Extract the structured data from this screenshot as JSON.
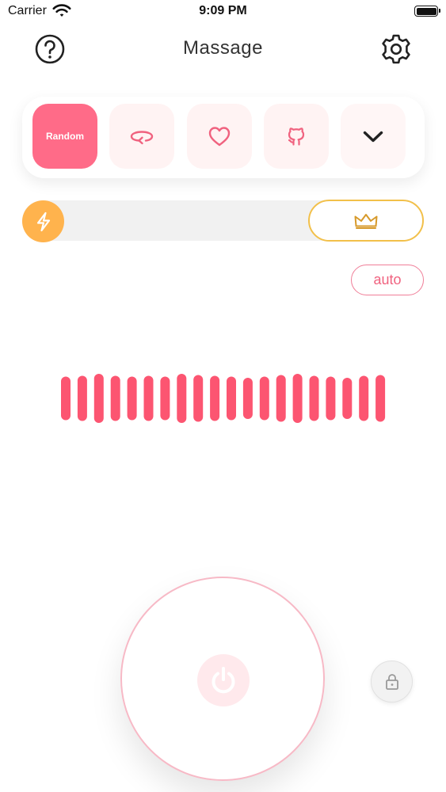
{
  "status_bar": {
    "carrier": "Carrier",
    "time": "9:09 PM"
  },
  "header": {
    "title": "Massage",
    "help_icon": "question-circle-icon",
    "settings_icon": "gear-icon"
  },
  "modes": {
    "items": [
      {
        "label": "Random",
        "icon": "",
        "active": true
      },
      {
        "label": "",
        "icon": "loop-arrow-icon",
        "active": false
      },
      {
        "label": "",
        "icon": "heart-icon",
        "active": false
      },
      {
        "label": "",
        "icon": "github-icon",
        "active": false
      },
      {
        "label": "",
        "icon": "chevron-down-icon",
        "active": false
      }
    ]
  },
  "intensity": {
    "knob_icon": "lightning-icon",
    "vip_icon": "crown-icon",
    "level": 0
  },
  "auto_button": {
    "label": "auto"
  },
  "visualizer": {
    "bar_heights": [
      55,
      57,
      62,
      57,
      55,
      57,
      55,
      62,
      59,
      57,
      55,
      52,
      55,
      59,
      62,
      57,
      55,
      52,
      57,
      59
    ],
    "color": "#fc5571"
  },
  "power": {
    "icon": "power-icon"
  },
  "lock": {
    "icon": "lock-icon"
  },
  "colors": {
    "accent": "#ff6b88",
    "accent_soft": "#fff3f3",
    "knob": "#ffb34d",
    "vip_border": "#f2c04a",
    "bar": "#fc5571"
  }
}
